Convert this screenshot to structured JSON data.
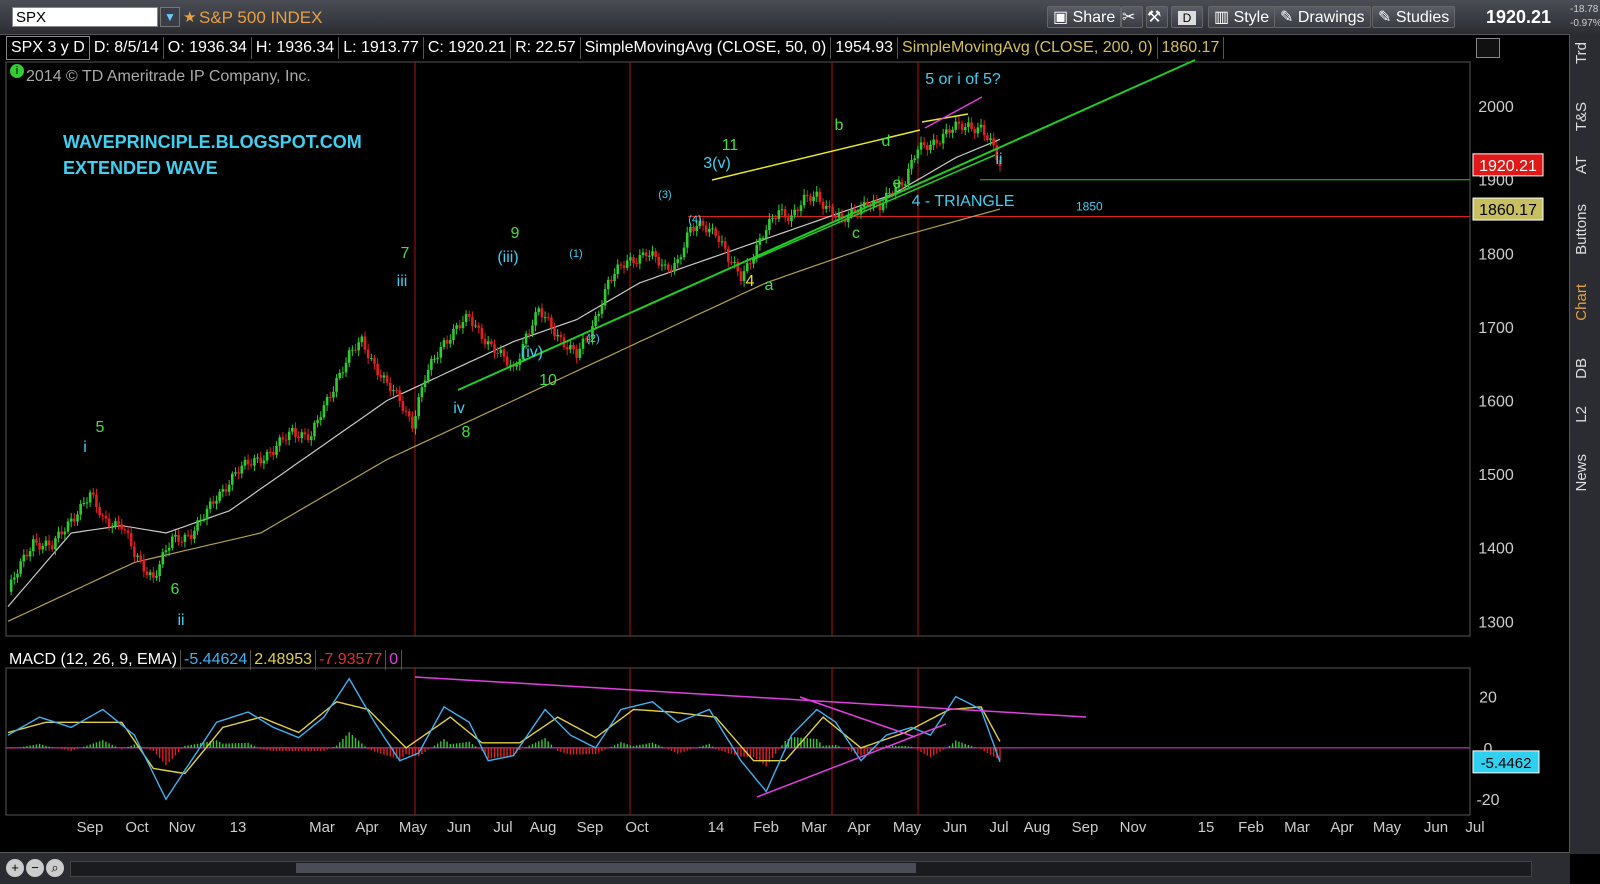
{
  "header": {
    "symbol": "SPX",
    "symbol_name": "S&P 500 INDEX",
    "share_label": "Share",
    "interval_label": "D",
    "style_label": "Style",
    "drawings_label": "Drawings",
    "studies_label": "Studies",
    "last_price": "1920.21",
    "net_change": "-18.78",
    "pct_change": "-0.97%"
  },
  "info": {
    "period": "SPX 3 y D",
    "date": "D: 8/5/14",
    "open": "O: 1936.34",
    "high": "H: 1936.34",
    "low": "L: 1913.77",
    "close": "C: 1920.21",
    "range": "R: 22.57",
    "sma50_label": "SimpleMovingAvg (CLOSE, 50, 0)",
    "sma50_value": "1954.93",
    "sma200_label": "SimpleMovingAvg (CLOSE, 200, 0)",
    "sma200_value": "1860.17"
  },
  "copyright": "2014 © TD Ameritrade IP Company, Inc.",
  "blog": {
    "line1": "WAVEPRINCIPLE.BLOGSPOT.COM",
    "line2": "EXTENDED WAVE"
  },
  "macd_info": {
    "label": "MACD (12, 26, 9, EMA)",
    "value": "-5.44624",
    "avg": "2.48953",
    "diff": "-7.93577",
    "zero": "0"
  },
  "side_tabs": [
    "Trd",
    "T&S",
    "AT",
    "Buttons",
    "Chart",
    "DB",
    "L2",
    "News"
  ],
  "colors": {
    "up": "#2ecc2e",
    "down": "#e02020",
    "sma50": "#c8c8c8",
    "sma200": "#b0a050",
    "trend": "#22cc22",
    "yellow": "#e8e820",
    "magenta": "#e040e0",
    "cyan": "#3fd0f0",
    "green_lbl": "#40e040",
    "vline": "#b01010",
    "macd": "#40b0f0",
    "signal": "#e0d040"
  },
  "chart_data": [
    {
      "type": "candlestick",
      "title": "SPX 3 y D",
      "ylim": [
        1280,
        2060
      ],
      "y_ticks": [
        1300,
        1400,
        1500,
        1600,
        1700,
        1800,
        1900,
        2000
      ],
      "x_ticks": [
        "Sep",
        "Oct",
        "Nov",
        "13",
        "Mar",
        "Apr",
        "May",
        "Jun",
        "Jul",
        "Aug",
        "Sep",
        "Oct",
        "14",
        "Feb",
        "Mar",
        "Apr",
        "May",
        "Jun",
        "Jul",
        "Aug",
        "Sep",
        "Nov",
        "15",
        "Feb",
        "Mar",
        "Apr",
        "May",
        "Jun",
        "Jul"
      ],
      "price_anchors_close": [
        [
          0,
          1340
        ],
        [
          8,
          1410
        ],
        [
          14,
          1400
        ],
        [
          20,
          1440
        ],
        [
          26,
          1470
        ],
        [
          30,
          1440
        ],
        [
          36,
          1430
        ],
        [
          40,
          1390
        ],
        [
          46,
          1360
        ],
        [
          52,
          1410
        ],
        [
          58,
          1420
        ],
        [
          62,
          1440
        ],
        [
          66,
          1470
        ],
        [
          72,
          1500
        ],
        [
          78,
          1520
        ],
        [
          84,
          1530
        ],
        [
          90,
          1560
        ],
        [
          96,
          1550
        ],
        [
          100,
          1590
        ],
        [
          104,
          1630
        ],
        [
          108,
          1660
        ],
        [
          112,
          1680
        ],
        [
          116,
          1650
        ],
        [
          120,
          1620
        ],
        [
          124,
          1600
        ],
        [
          128,
          1570
        ],
        [
          132,
          1630
        ],
        [
          138,
          1680
        ],
        [
          142,
          1700
        ],
        [
          146,
          1710
        ],
        [
          150,
          1690
        ],
        [
          156,
          1660
        ],
        [
          160,
          1640
        ],
        [
          164,
          1690
        ],
        [
          168,
          1720
        ],
        [
          172,
          1700
        ],
        [
          176,
          1680
        ],
        [
          180,
          1660
        ],
        [
          184,
          1690
        ],
        [
          190,
          1760
        ],
        [
          196,
          1790
        ],
        [
          202,
          1800
        ],
        [
          208,
          1780
        ],
        [
          212,
          1790
        ],
        [
          216,
          1830
        ],
        [
          220,
          1840
        ],
        [
          224,
          1830
        ],
        [
          228,
          1790
        ],
        [
          232,
          1770
        ],
        [
          236,
          1800
        ],
        [
          240,
          1830
        ],
        [
          244,
          1860
        ],
        [
          248,
          1850
        ],
        [
          252,
          1870
        ],
        [
          256,
          1880
        ],
        [
          260,
          1860
        ],
        [
          264,
          1840
        ],
        [
          268,
          1860
        ],
        [
          272,
          1870
        ],
        [
          276,
          1860
        ],
        [
          280,
          1890
        ],
        [
          284,
          1900
        ],
        [
          288,
          1940
        ],
        [
          292,
          1950
        ],
        [
          296,
          1960
        ],
        [
          300,
          1970
        ],
        [
          304,
          1975
        ],
        [
          308,
          1970
        ],
        [
          312,
          1940
        ],
        [
          314,
          1920
        ]
      ],
      "sma50": [
        [
          0,
          1320
        ],
        [
          20,
          1420
        ],
        [
          36,
          1430
        ],
        [
          50,
          1420
        ],
        [
          70,
          1450
        ],
        [
          100,
          1540
        ],
        [
          120,
          1600
        ],
        [
          140,
          1640
        ],
        [
          160,
          1680
        ],
        [
          180,
          1710
        ],
        [
          200,
          1760
        ],
        [
          220,
          1790
        ],
        [
          240,
          1820
        ],
        [
          260,
          1850
        ],
        [
          280,
          1880
        ],
        [
          300,
          1930
        ],
        [
          314,
          1954.93
        ]
      ],
      "sma200": [
        [
          0,
          1300
        ],
        [
          40,
          1380
        ],
        [
          80,
          1420
        ],
        [
          120,
          1520
        ],
        [
          160,
          1600
        ],
        [
          200,
          1680
        ],
        [
          240,
          1760
        ],
        [
          280,
          1820
        ],
        [
          314,
          1860.17
        ]
      ],
      "horizontal_lines": [
        {
          "value": 1900,
          "color": "green"
        },
        {
          "value": 1850,
          "color": "red",
          "label": "1850"
        }
      ],
      "price_labels": [
        {
          "value": 1920.21,
          "text": "1920.21"
        },
        {
          "value": 1860.17,
          "text": "1860.17"
        }
      ],
      "annotations": [
        {
          "text": "5",
          "color": "green"
        },
        {
          "text": "i",
          "color": "cyan"
        },
        {
          "text": "6",
          "color": "green"
        },
        {
          "text": "ii",
          "color": "cyan"
        },
        {
          "text": "7",
          "color": "green"
        },
        {
          "text": "iii",
          "color": "cyan"
        },
        {
          "text": "8",
          "color": "green"
        },
        {
          "text": "iv",
          "color": "cyan"
        },
        {
          "text": "9",
          "color": "green"
        },
        {
          "text": "(iii)",
          "color": "cyan"
        },
        {
          "text": "10",
          "color": "green"
        },
        {
          "text": "(iv)",
          "color": "cyan"
        },
        {
          "text": "(1)",
          "color": "cyan"
        },
        {
          "text": "(2)",
          "color": "cyan"
        },
        {
          "text": "(3)",
          "color": "cyan"
        },
        {
          "text": "(4)",
          "color": "cyan"
        },
        {
          "text": "11",
          "color": "green"
        },
        {
          "text": "3(v)",
          "color": "cyan"
        },
        {
          "text": "4",
          "color": "yellow"
        },
        {
          "text": "a",
          "color": "green"
        },
        {
          "text": "b",
          "color": "green"
        },
        {
          "text": "c",
          "color": "green"
        },
        {
          "text": "d",
          "color": "green"
        },
        {
          "text": "e",
          "color": "green"
        },
        {
          "text": "4 - TRIANGLE",
          "color": "cyan"
        },
        {
          "text": "5 or i of 5?",
          "color": "cyan"
        },
        {
          "text": "ii",
          "color": "cyan"
        }
      ]
    },
    {
      "type": "line",
      "title": "MACD (12, 26, 9, EMA)",
      "ylim": [
        -25,
        30
      ],
      "y_ticks": [
        -20,
        0,
        20
      ],
      "series": [
        {
          "name": "Value",
          "values": [
            [
              0,
              5
            ],
            [
              10,
              12
            ],
            [
              20,
              8
            ],
            [
              30,
              15
            ],
            [
              40,
              5
            ],
            [
              50,
              -20
            ],
            [
              58,
              -5
            ],
            [
              66,
              10
            ],
            [
              76,
              14
            ],
            [
              84,
              8
            ],
            [
              92,
              4
            ],
            [
              100,
              12
            ],
            [
              108,
              27
            ],
            [
              116,
              10
            ],
            [
              124,
              -5
            ],
            [
              130,
              -2
            ],
            [
              138,
              16
            ],
            [
              146,
              10
            ],
            [
              152,
              -5
            ],
            [
              160,
              -3
            ],
            [
              170,
              15
            ],
            [
              178,
              5
            ],
            [
              186,
              0
            ],
            [
              194,
              15
            ],
            [
              204,
              18
            ],
            [
              212,
              10
            ],
            [
              222,
              15
            ],
            [
              232,
              -5
            ],
            [
              240,
              -17
            ],
            [
              248,
              5
            ],
            [
              256,
              15
            ],
            [
              262,
              10
            ],
            [
              270,
              -5
            ],
            [
              278,
              5
            ],
            [
              286,
              8
            ],
            [
              292,
              5
            ],
            [
              300,
              20
            ],
            [
              308,
              15
            ],
            [
              314,
              -5.44624
            ]
          ]
        },
        {
          "name": "Avg",
          "values": [
            [
              0,
              6
            ],
            [
              12,
              10
            ],
            [
              24,
              10
            ],
            [
              36,
              10
            ],
            [
              46,
              -8
            ],
            [
              56,
              -10
            ],
            [
              68,
              8
            ],
            [
              80,
              12
            ],
            [
              92,
              6
            ],
            [
              104,
              18
            ],
            [
              114,
              15
            ],
            [
              126,
              0
            ],
            [
              140,
              12
            ],
            [
              150,
              2
            ],
            [
              162,
              2
            ],
            [
              174,
              12
            ],
            [
              186,
              4
            ],
            [
              198,
              15
            ],
            [
              210,
              14
            ],
            [
              224,
              12
            ],
            [
              236,
              -5
            ],
            [
              246,
              -5
            ],
            [
              258,
              12
            ],
            [
              270,
              0
            ],
            [
              284,
              6
            ],
            [
              298,
              15
            ],
            [
              308,
              16
            ],
            [
              314,
              2.48953
            ]
          ]
        }
      ]
    }
  ]
}
